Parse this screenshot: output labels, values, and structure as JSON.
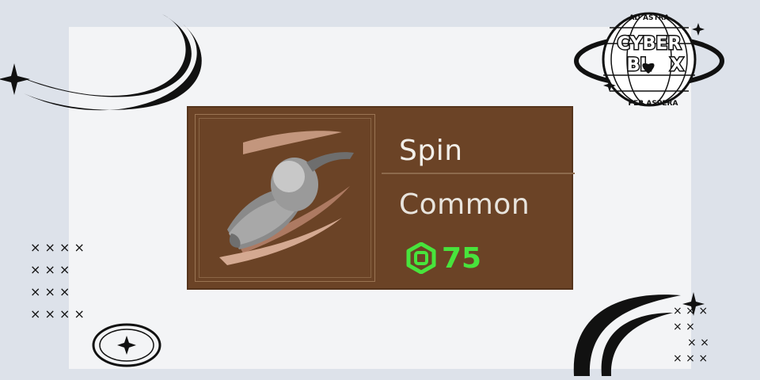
{
  "item": {
    "name": "Spin",
    "rarity": "Common",
    "price": "75",
    "currency_icon": "robux-icon",
    "price_color": "#48e43c"
  },
  "logo": {
    "top_arc": "AD ASTRA",
    "line1": "CYBER",
    "line2": "BL",
    "line2b": "X",
    "bottom_arc": "PER ASPERA"
  },
  "colors": {
    "background": "#dde2ea",
    "card": "#f3f4f6",
    "item_panel": "#6b4326"
  }
}
